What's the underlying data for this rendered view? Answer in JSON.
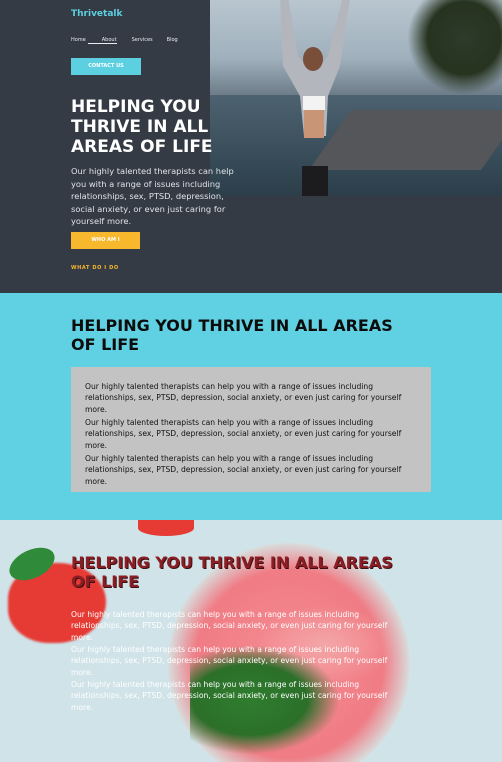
{
  "brand": {
    "logo": "Thrivetalk"
  },
  "nav": {
    "home": "Home",
    "about": "About",
    "services": "Services",
    "blog": "Blog"
  },
  "hero": {
    "contact_label": "CONTACT US",
    "title": "HELPING YOU THRIVE IN ALL AREAS OF LIFE",
    "text": "Our highly talented therapists can help you with a range of issues including relationships, sex, PTSD, depression, social anxiety, or even just caring for yourself more.",
    "who_label": "WHO AM I",
    "what_label": "WHAT DO I DO"
  },
  "section_blue": {
    "title": "HELPING YOU THRIVE IN ALL AREAS OF LIFE",
    "paragraphs": [
      "Our highly talented therapists can help you with a range of issues including relationships, sex, PTSD, depression, social anxiety, or even just caring for yourself more.",
      "Our highly talented therapists can help you with a range of issues including relationships, sex, PTSD, depression, social anxiety, or even just caring for yourself more.",
      "Our highly talented therapists can help you with a range of issues including relationships, sex, PTSD, depression, social anxiety, or even just caring for yourself more."
    ]
  },
  "section_photo": {
    "title": "HELPING YOU THRIVE IN ALL AREAS OF LIFE",
    "paragraphs": [
      "Our highly talented therapists can help you with a range of issues including relationships, sex, PTSD, depression, social anxiety, or even just caring for yourself more.",
      "Our highly talented therapists can help you with a range of issues including relationships, sex, PTSD, depression, social anxiety, or even just caring for yourself more.",
      "Our highly talented therapists can help you with a range of issues including relationships, sex, PTSD, depression, social anxiety, or even just caring for yourself more."
    ]
  },
  "colors": {
    "dark_bg": "#353b44",
    "accent_cyan": "#5ccfe1",
    "accent_yellow": "#f7b82e",
    "panel_grey": "#c3c3c3",
    "title_red": "#8b1e24"
  }
}
